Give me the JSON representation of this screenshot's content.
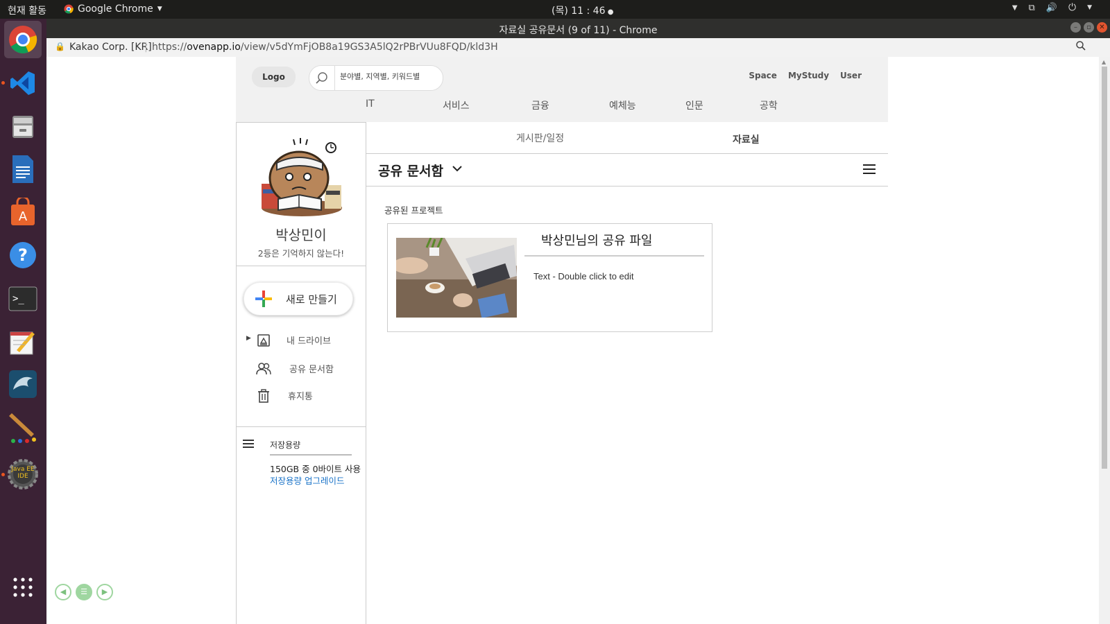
{
  "system": {
    "activities_label": "현재 활동",
    "app_menu_label": "Google Chrome",
    "clock": "(목) 11 : 46"
  },
  "window": {
    "title": "자료실 공유문서 (9 of 11) - Chrome"
  },
  "addressbar": {
    "org": "Kakao Corp. [KR]",
    "url_scheme": "https://",
    "url_host": "ovenapp.io",
    "url_path": "/view/v5dYmFjOB8a19GS3A5lQ2rPBrVUu8FQD/kld3H"
  },
  "dock": {
    "items": [
      "chrome",
      "vscode",
      "files",
      "writer",
      "software-center",
      "help",
      "terminal",
      "text-editor",
      "mysql-workbench",
      "paint",
      "java-ee-ide"
    ],
    "java_label_1": "Java EE",
    "java_label_2": "IDE"
  },
  "header": {
    "logo": "Logo",
    "search_placeholder": "분야별, 지역별, 키워드별",
    "links": [
      "Space",
      "MyStudy",
      "User"
    ],
    "categories": [
      "IT",
      "서비스",
      "금융",
      "예체능",
      "인문",
      "공학"
    ]
  },
  "sidebar": {
    "profile_name": "박상민이",
    "profile_message": "2등은 기억하지 않는다!",
    "new_button": "새로 만들기",
    "nav": [
      "내 드라이브",
      "공유 문서함",
      "휴지통"
    ],
    "storage_title": "저장용량",
    "storage_usage": "150GB 중 0바이트 사용",
    "storage_upgrade": "저장용량 업그레이드"
  },
  "main": {
    "tabs": [
      "게시판/일정",
      "자료실"
    ],
    "folder_title": "공유 문서함",
    "section_label": "공유된 프로젝트",
    "card": {
      "title": "박상민님의 공유 파일",
      "text": "Text - Double click to edit"
    }
  },
  "colors": {
    "accent_link": "#1a73c8",
    "dock_bg": "#3b2235",
    "header_bg": "#f1f1f1"
  }
}
